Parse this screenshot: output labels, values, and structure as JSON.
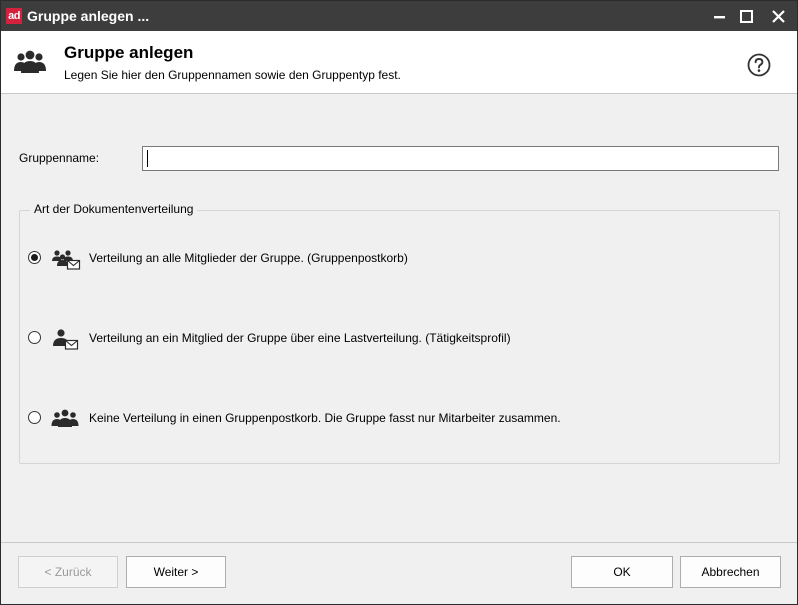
{
  "window": {
    "app_logo_text": "ad",
    "title": "Gruppe anlegen ...",
    "brand_color": "#d4213d",
    "titlebar_color": "#3d3d3d"
  },
  "header": {
    "icon": "group-icon",
    "title": "Gruppe anlegen",
    "subtitle": "Legen Sie hier den Gruppennamen sowie den Gruppentyp fest.",
    "help_icon": "help-icon"
  },
  "form": {
    "group_name_label": "Gruppenname:",
    "group_name_value": "",
    "group_name_placeholder": ""
  },
  "distribution": {
    "legend": "Art der Dokumentenverteilung",
    "selected_index": 0,
    "options": [
      {
        "label": "Verteilung an alle Mitglieder der Gruppe. (Gruppenpostkorb)",
        "icon": "group-mail-icon",
        "selected": true
      },
      {
        "label": "Verteilung an ein Mitglied der Gruppe über eine Lastverteilung. (Tätigkeitsprofil)",
        "icon": "person-mail-icon",
        "selected": false
      },
      {
        "label": "Keine Verteilung in einen Gruppenpostkorb. Die Gruppe fasst nur Mitarbeiter zusammen.",
        "icon": "group-icon",
        "selected": false
      }
    ]
  },
  "buttons": {
    "back": "< Zurück",
    "back_enabled": false,
    "next": "Weiter >",
    "ok": "OK",
    "cancel": "Abbrechen"
  }
}
